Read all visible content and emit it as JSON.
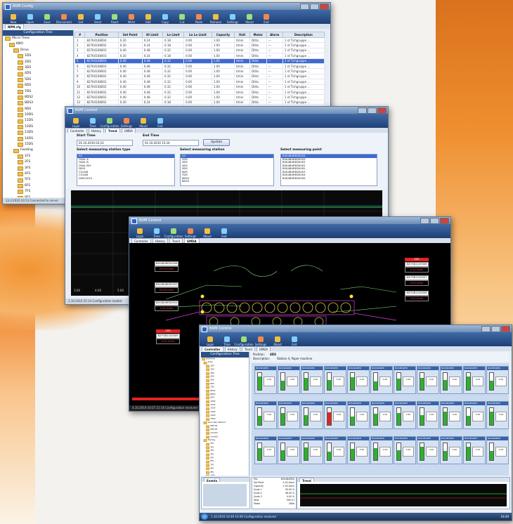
{
  "colors": {
    "accent": "#3f6ad0",
    "toolbar": "#1f3f75",
    "alarm": "#e52222",
    "gauge": "#2fb02f"
  },
  "win1": {
    "title": "NVM Config",
    "tab": "NPM.cfg",
    "toolbar": [
      "New",
      "Open",
      "Save",
      "Disconnect",
      "Get",
      "Send",
      "Read",
      "Write",
      "Edit",
      "Copy",
      "Cut",
      "Paste",
      "Remove",
      "Settings",
      "About",
      "Exit"
    ],
    "tree_title": "Configuration Tree",
    "tree": [
      {
        "label": "Micro Trees",
        "level": 0
      },
      {
        "label": "KNO",
        "level": 1
      },
      {
        "label": "Drive",
        "level": 2
      },
      {
        "label": "1DS",
        "level": 3
      },
      {
        "label": "2DS",
        "level": 3
      },
      {
        "label": "3DS",
        "level": 3
      },
      {
        "label": "4DS",
        "level": 3
      },
      {
        "label": "5DS",
        "level": 3
      },
      {
        "label": "6DS",
        "level": 3
      },
      {
        "label": "7DS",
        "level": 3
      },
      {
        "label": "8DS2",
        "level": 3
      },
      {
        "label": "8DS3",
        "level": 3
      },
      {
        "label": "9DS",
        "level": 3
      },
      {
        "label": "10DS",
        "level": 3
      },
      {
        "label": "11DS",
        "level": 3
      },
      {
        "label": "12DS",
        "level": 3
      },
      {
        "label": "13DS",
        "level": 3
      },
      {
        "label": "14DS",
        "level": 3
      },
      {
        "label": "15DS",
        "level": 3
      },
      {
        "label": "Feeding",
        "level": 2
      },
      {
        "label": "1FS",
        "level": 3
      },
      {
        "label": "2FS",
        "level": 3
      },
      {
        "label": "3FS",
        "level": 3
      },
      {
        "label": "4FS",
        "level": 3
      },
      {
        "label": "5FS",
        "level": 3
      },
      {
        "label": "6FS",
        "level": 3
      },
      {
        "label": "7FS",
        "level": 3
      },
      {
        "label": "8FS",
        "level": 3
      },
      {
        "label": "9FS",
        "level": 3
      },
      {
        "label": "10FS",
        "level": 3
      },
      {
        "label": "11FS",
        "level": 3
      }
    ],
    "columns": [
      "#",
      "Position",
      "Set Point",
      "Hi Limit",
      "Lo Limit",
      "Lo Lo Limit",
      "Capacity",
      "Unit",
      "Motor",
      "Alarm",
      "Description"
    ],
    "rows": [
      [
        "1",
        "827K4108004",
        "0.20",
        "0.24",
        "0.18",
        "0.00",
        "1.00",
        "t/min",
        "Ditto",
        "---",
        "1 st Tichgruppe ..."
      ],
      [
        "2",
        "827K4108002",
        "0.20",
        "0.24",
        "0.18",
        "0.00",
        "1.00",
        "t/min",
        "Ditto",
        "---",
        "1 st Tichgruppe ..."
      ],
      [
        "3",
        "827K4108003",
        "0.40",
        "0.48",
        "0.32",
        "0.00",
        "1.00",
        "t/min",
        "Ditto",
        "---",
        "1 st Tichgruppe ..."
      ],
      [
        "4",
        "827K4108003",
        "0.20",
        "0.24",
        "0.18",
        "0.00",
        "1.00",
        "t/min",
        "Ditto",
        "---",
        "1 st Tichgruppe ..."
      ],
      [
        "5",
        "827K4108003",
        "0.40",
        "0.48",
        "0.32",
        "0.00",
        "1.00",
        "t/min",
        "Ditto",
        "---",
        "1 st Tichgruppe ..."
      ],
      [
        "6",
        "827K4108003",
        "0.40",
        "0.48",
        "0.32",
        "0.00",
        "1.00",
        "t/min",
        "Ditto",
        "---",
        "1 st Tichgruppe ..."
      ],
      [
        "7",
        "827K4108002",
        "0.40",
        "0.48",
        "0.32",
        "0.00",
        "1.00",
        "t/min",
        "Ditto",
        "---",
        "1 st Tichgruppe ..."
      ],
      [
        "8",
        "827K4108002",
        "0.40",
        "0.48",
        "0.32",
        "0.00",
        "1.00",
        "t/min",
        "Ditto",
        "---",
        "1 st Tichgruppe ..."
      ],
      [
        "9",
        "827K4108002",
        "0.40",
        "0.48",
        "0.32",
        "0.00",
        "1.00",
        "t/min",
        "Ditto",
        "---",
        "1 st Tichgruppe ..."
      ],
      [
        "10",
        "827K4108002",
        "0.40",
        "0.48",
        "0.32",
        "0.00",
        "1.00",
        "t/min",
        "Ditto",
        "---",
        "1 st Tichgruppe ..."
      ],
      [
        "11",
        "827K4108002",
        "0.40",
        "0.48",
        "0.32",
        "0.00",
        "1.00",
        "t/min",
        "Ditto",
        "---",
        "1 st Tichgruppe ..."
      ],
      [
        "12",
        "827K4108002",
        "0.40",
        "0.48",
        "0.32",
        "0.00",
        "1.00",
        "t/min",
        "Ditto",
        "---",
        "1 st Tichgruppe ..."
      ],
      [
        "13",
        "827K4108002",
        "0.20",
        "0.24",
        "0.18",
        "0.00",
        "1.00",
        "t/min",
        "Ditto",
        "---",
        "1 st Tichgruppe ..."
      ],
      [
        "14",
        "827K4108002",
        "0.20",
        "0.24",
        "0.18",
        "0.00",
        "1.00",
        "t/min",
        "Ditto",
        "---",
        "1 st Tichgruppe ..."
      ]
    ],
    "selected_row": 4,
    "status": "13.4.2010 10:53  Connected to server"
  },
  "win2": {
    "title": "NVM Control",
    "toolbar": [
      "Login",
      "Time",
      "Configuration",
      "Settings",
      "About",
      "Exit"
    ],
    "tabs": [
      "Controller",
      "History",
      "Trend",
      "GMDA"
    ],
    "active_tab": "Trend",
    "start_label": "Start Time",
    "start_value": "01.10.2010 03:14",
    "end_label": "End Time",
    "end_value": "01.10.2010 15:14",
    "update_label": "Update",
    "type_label": "Select measuring station type",
    "types": [
      "All",
      "OVAL A",
      "OVAL B",
      "OVAL B/Y",
      "DEGI",
      "COLAB",
      "COLAB",
      "GWC2010"
    ],
    "station_label": "Select measuring station",
    "stations": [
      "All",
      "2DS",
      "3DS",
      "4DS",
      "5DS",
      "6DS",
      "7DS",
      "8DS2",
      "8DS3"
    ],
    "point_label": "Select measuring point",
    "points": [
      "B2K4B4RED0004",
      "B2K4B4RED0003",
      "B2K4B4RED0002",
      "B2K4B4RED0001",
      "B2K4B4RED0002",
      "B2K4B4RED0003",
      "B2K4B4RED0004",
      "B2K4B4RED0005"
    ],
    "axis_ticks": [
      "3:00",
      "4:00",
      "5:00"
    ],
    "status": "1.10.2010 15:14  Configuration loaded"
  },
  "win3": {
    "title": "NVM Control",
    "toolbar": [
      "Login",
      "Time",
      "Configuration",
      "Settings",
      "About",
      "Exit"
    ],
    "tabs": [
      "Controller",
      "History",
      "Trend",
      "GMDA"
    ],
    "active_tab": "GMDA",
    "tags": [
      {
        "header": "",
        "code": "B2K4B4RED0008",
        "value": "20.00 t/min"
      },
      {
        "header": "",
        "code": "B2K4B4RED0003",
        "value": "20.00 t/min"
      },
      {
        "header": "",
        "code": "B2K4B4RED0004",
        "value": "1.00 t/min"
      },
      {
        "header": "4DS",
        "code": "B2I7SB1C00006",
        "value": "0.20 t/min"
      },
      {
        "header": "",
        "code": "B2I7SB1C00007",
        "value": "0.20 t/min"
      },
      {
        "header": "",
        "code": "B2I7SB1C00008",
        "value": "0.20 t/min"
      },
      {
        "header": "1DS",
        "code": "B2I7SB1C00009",
        "value": "0.20 t/min"
      }
    ],
    "status": "4.10.2010 10:57  21:14 Configuration received"
  },
  "win4": {
    "title": "NVM Control",
    "toolbar": [
      "Login",
      "Time",
      "Configuration",
      "Settings",
      "About",
      "Exit"
    ],
    "tabs": [
      "Controller",
      "History",
      "Trend",
      "GMDA"
    ],
    "active_tab": "Controller",
    "tree_title": "Configuration Tree",
    "tree": [
      "NVM Hills",
      "Drive",
      "1DS",
      "2DS",
      "3DS",
      "4DS",
      "5DS",
      "6DS",
      "7DS",
      "8DS2",
      "8DS3",
      "9DS",
      "10DS",
      "11DS",
      "12DS",
      "13DS",
      "14DS",
      "15DS",
      "Secondary Restrict",
      "FEM 1B",
      "FEM 1B",
      "Card B1",
      "Card B2",
      "Feeding",
      "1FS",
      "2FS",
      "3FS",
      "4FS",
      "5FS",
      "6FS",
      "7FS",
      "8FS",
      "9FS",
      "10FS"
    ],
    "position_label": "Position:",
    "position_value": "4DS",
    "desc_label": "Description:",
    "desc_value": "Station 4, Paper machine",
    "tile_label": "B2K4B4RED",
    "tile_value": "0.20",
    "info": [
      [
        "Pos",
        "B2K4B4RED"
      ],
      [
        "Set Point",
        "0.20 t/min"
      ],
      [
        "Capacity",
        "1.00 t/min"
      ],
      [
        "Scale 1",
        "99.00 %"
      ],
      [
        "Scale 2",
        "98.00 %"
      ],
      [
        "Scale 3",
        "0.00 %"
      ],
      [
        "Total",
        "399.0 t"
      ],
      [
        "Motor",
        "Ditto"
      ]
    ],
    "events_tab": "Events",
    "trend_tab": "Trend",
    "status": "1.10.2010 10:49  10:49 Configuration received",
    "clock": "16:49"
  }
}
